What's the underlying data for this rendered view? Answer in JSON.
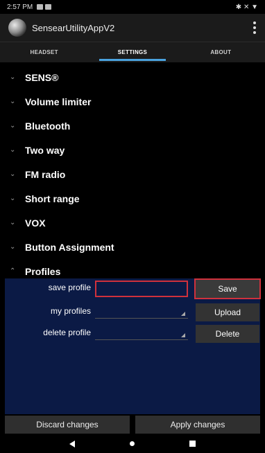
{
  "status_bar": {
    "time": "2:57 PM",
    "right_text": "✱ ✕ ▼"
  },
  "app": {
    "title": "SensearUtilityAppV2"
  },
  "tabs": [
    {
      "label": "HEADSET",
      "active": false
    },
    {
      "label": "SETTINGS",
      "active": true
    },
    {
      "label": "ABOUT",
      "active": false
    }
  ],
  "sections": [
    {
      "label": "SENS®",
      "chevron": "⌄"
    },
    {
      "label": "Volume limiter",
      "chevron": "⌄"
    },
    {
      "label": "Bluetooth",
      "chevron": "⌄"
    },
    {
      "label": "Two way",
      "chevron": "⌄"
    },
    {
      "label": "FM radio",
      "chevron": "⌄"
    },
    {
      "label": "Short range",
      "chevron": "⌄"
    },
    {
      "label": "VOX",
      "chevron": "⌄"
    },
    {
      "label": "Button Assignment",
      "chevron": "⌄"
    },
    {
      "label": "Profiles",
      "chevron": "⌃"
    }
  ],
  "profiles": {
    "save_label": "save profile",
    "save_input_value": "",
    "save_button": "Save",
    "my_profiles_label": "my profiles",
    "upload_button": "Upload",
    "delete_label": "delete profile",
    "delete_button": "Delete"
  },
  "bottom": {
    "discard": "Discard changes",
    "apply": "Apply changes"
  },
  "colors": {
    "accent": "#4aa3df",
    "highlight": "#d0313c",
    "panel": "#0b1a45"
  }
}
